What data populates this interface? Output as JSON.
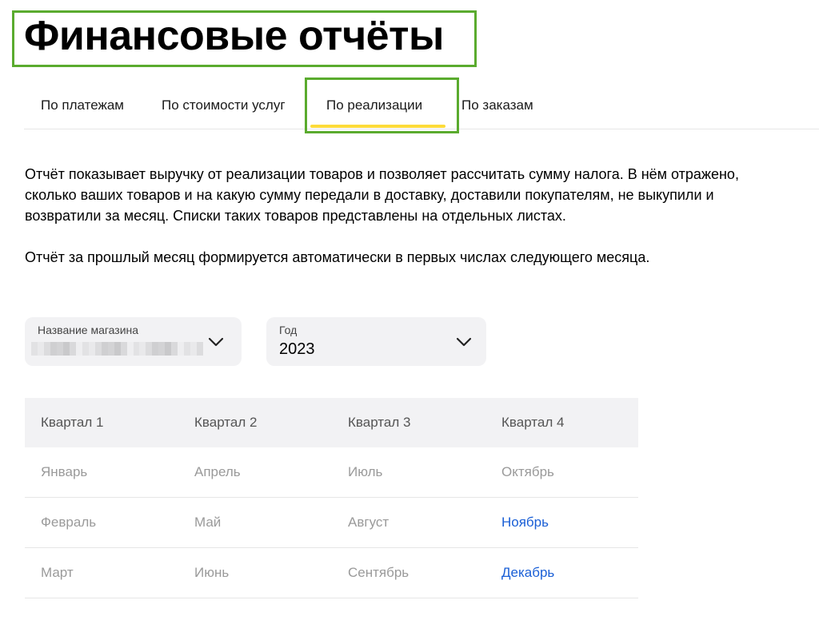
{
  "page": {
    "title": "Финансовые отчёты"
  },
  "tabs": [
    {
      "label": "По платежам",
      "active": false
    },
    {
      "label": "По стоимости услуг",
      "active": false
    },
    {
      "label": "По реализации",
      "active": true
    },
    {
      "label": "По заказам",
      "active": false
    }
  ],
  "description": {
    "paragraph_1": "Отчёт показывает выручку от реализации товаров и позволяет рассчитать сумму налога. В нём отражено, сколько ваших товаров и на какую сумму передали в доставку, доставили покупателям, не выкупили и возвратили за месяц. Списки таких товаров представлены на отдельных листах.",
    "paragraph_2": "Отчёт за прошлый месяц формируется автоматически в первых числах следующего месяца."
  },
  "filters": {
    "store": {
      "label": "Название магазина",
      "value": ""
    },
    "year": {
      "label": "Год",
      "value": "2023"
    }
  },
  "table": {
    "headers": [
      "Квартал 1",
      "Квартал 2",
      "Квартал 3",
      "Квартал 4"
    ],
    "rows": [
      [
        "Январь",
        "Апрель",
        "Июль",
        "Октябрь"
      ],
      [
        "Февраль",
        "Май",
        "Август",
        "Ноябрь"
      ],
      [
        "Март",
        "Июнь",
        "Сентябрь",
        "Декабрь"
      ]
    ]
  },
  "colors": {
    "highlight_border": "#5aab2e",
    "tab_underline": "#fddb3a",
    "link": "#1a5fd6",
    "muted_text": "#9a9a9a",
    "panel_bg": "#f2f2f4"
  }
}
